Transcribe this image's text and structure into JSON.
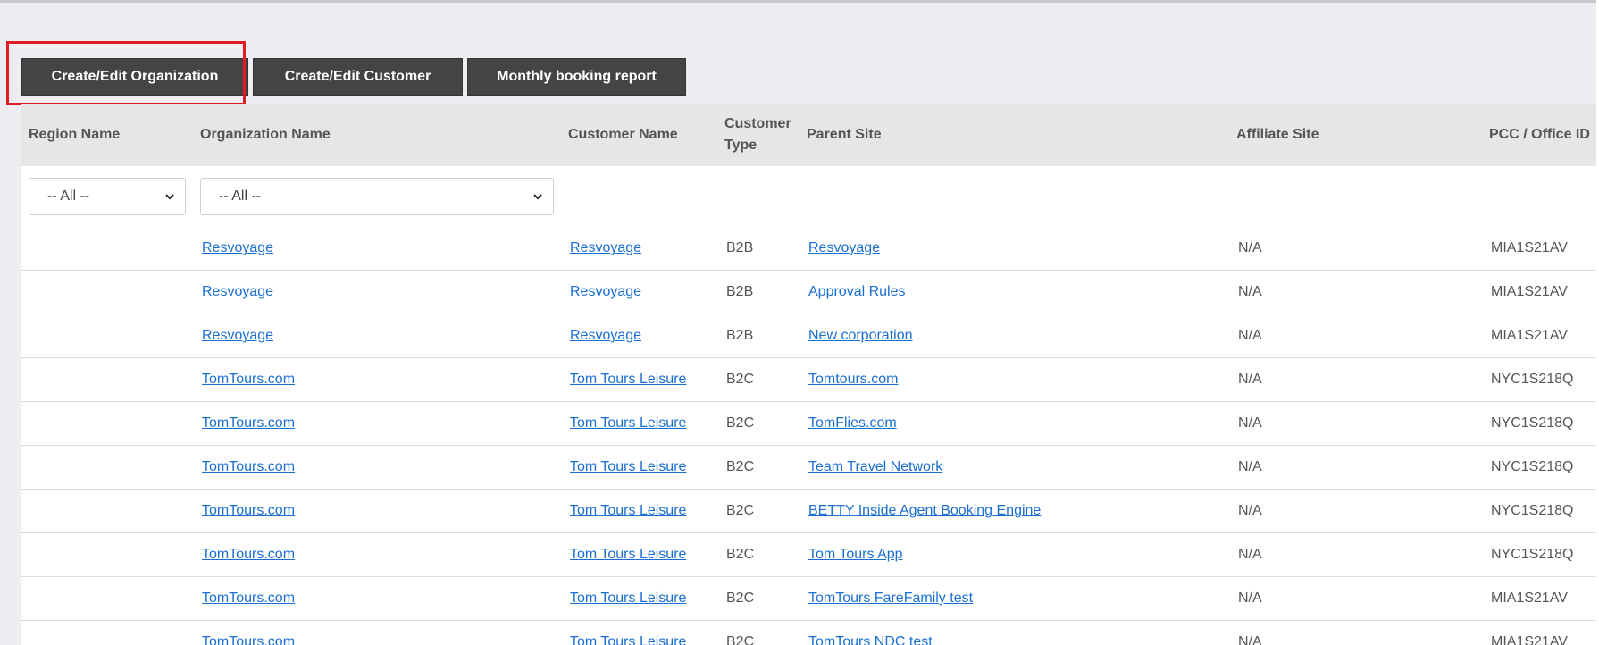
{
  "toolbar": {
    "create_org_label": "Create/Edit Organization",
    "create_customer_label": "Create/Edit Customer",
    "monthly_report_label": "Monthly booking report"
  },
  "table": {
    "headers": {
      "region": "Region Name",
      "organization": "Organization Name",
      "customer": "Customer Name",
      "customer_type": "Customer Type",
      "parent_site": "Parent Site",
      "affiliate_site": "Affiliate Site",
      "pcc": "PCC / Office ID"
    },
    "filters": {
      "region_selected": "-- All --",
      "organization_selected": "-- All --"
    },
    "rows": [
      {
        "region": "",
        "organization": "Resvoyage",
        "customer": "Resvoyage",
        "customer_type": "B2B",
        "parent_site": "Resvoyage",
        "affiliate_site": "N/A",
        "pcc": "MIA1S21AV"
      },
      {
        "region": "",
        "organization": "Resvoyage",
        "customer": "Resvoyage",
        "customer_type": "B2B",
        "parent_site": "Approval Rules",
        "affiliate_site": "N/A",
        "pcc": "MIA1S21AV"
      },
      {
        "region": "",
        "organization": "Resvoyage",
        "customer": "Resvoyage",
        "customer_type": "B2B",
        "parent_site": "New corporation",
        "affiliate_site": "N/A",
        "pcc": "MIA1S21AV"
      },
      {
        "region": "",
        "organization": "TomTours.com",
        "customer": "Tom Tours Leisure",
        "customer_type": "B2C",
        "parent_site": "Tomtours.com",
        "affiliate_site": "N/A",
        "pcc": "NYC1S218Q"
      },
      {
        "region": "",
        "organization": "TomTours.com",
        "customer": "Tom Tours Leisure",
        "customer_type": "B2C",
        "parent_site": "TomFlies.com",
        "affiliate_site": "N/A",
        "pcc": "NYC1S218Q"
      },
      {
        "region": "",
        "organization": "TomTours.com",
        "customer": "Tom Tours Leisure",
        "customer_type": "B2C",
        "parent_site": "Team Travel Network",
        "affiliate_site": "N/A",
        "pcc": "NYC1S218Q"
      },
      {
        "region": "",
        "organization": "TomTours.com",
        "customer": "Tom Tours Leisure",
        "customer_type": "B2C",
        "parent_site": "BETTY Inside Agent Booking Engine",
        "affiliate_site": "N/A",
        "pcc": "NYC1S218Q"
      },
      {
        "region": "",
        "organization": "TomTours.com",
        "customer": "Tom Tours Leisure",
        "customer_type": "B2C",
        "parent_site": "Tom Tours App",
        "affiliate_site": "N/A",
        "pcc": "NYC1S218Q"
      },
      {
        "region": "",
        "organization": "TomTours.com",
        "customer": "Tom Tours Leisure",
        "customer_type": "B2C",
        "parent_site": "TomTours FareFamily test",
        "affiliate_site": "N/A",
        "pcc": "MIA1S21AV"
      },
      {
        "region": "",
        "organization": "TomTours.com",
        "customer": "Tom Tours Leisure",
        "customer_type": "B2C",
        "parent_site": "TomTours NDC test",
        "affiliate_site": "N/A",
        "pcc": "MIA1S21AV"
      }
    ]
  },
  "colors": {
    "button_bg": "#444444",
    "header_bg": "#e6e6e6",
    "link": "#1a6fd1",
    "highlight": "#e01b24",
    "page_bg": "#eeeef2"
  }
}
